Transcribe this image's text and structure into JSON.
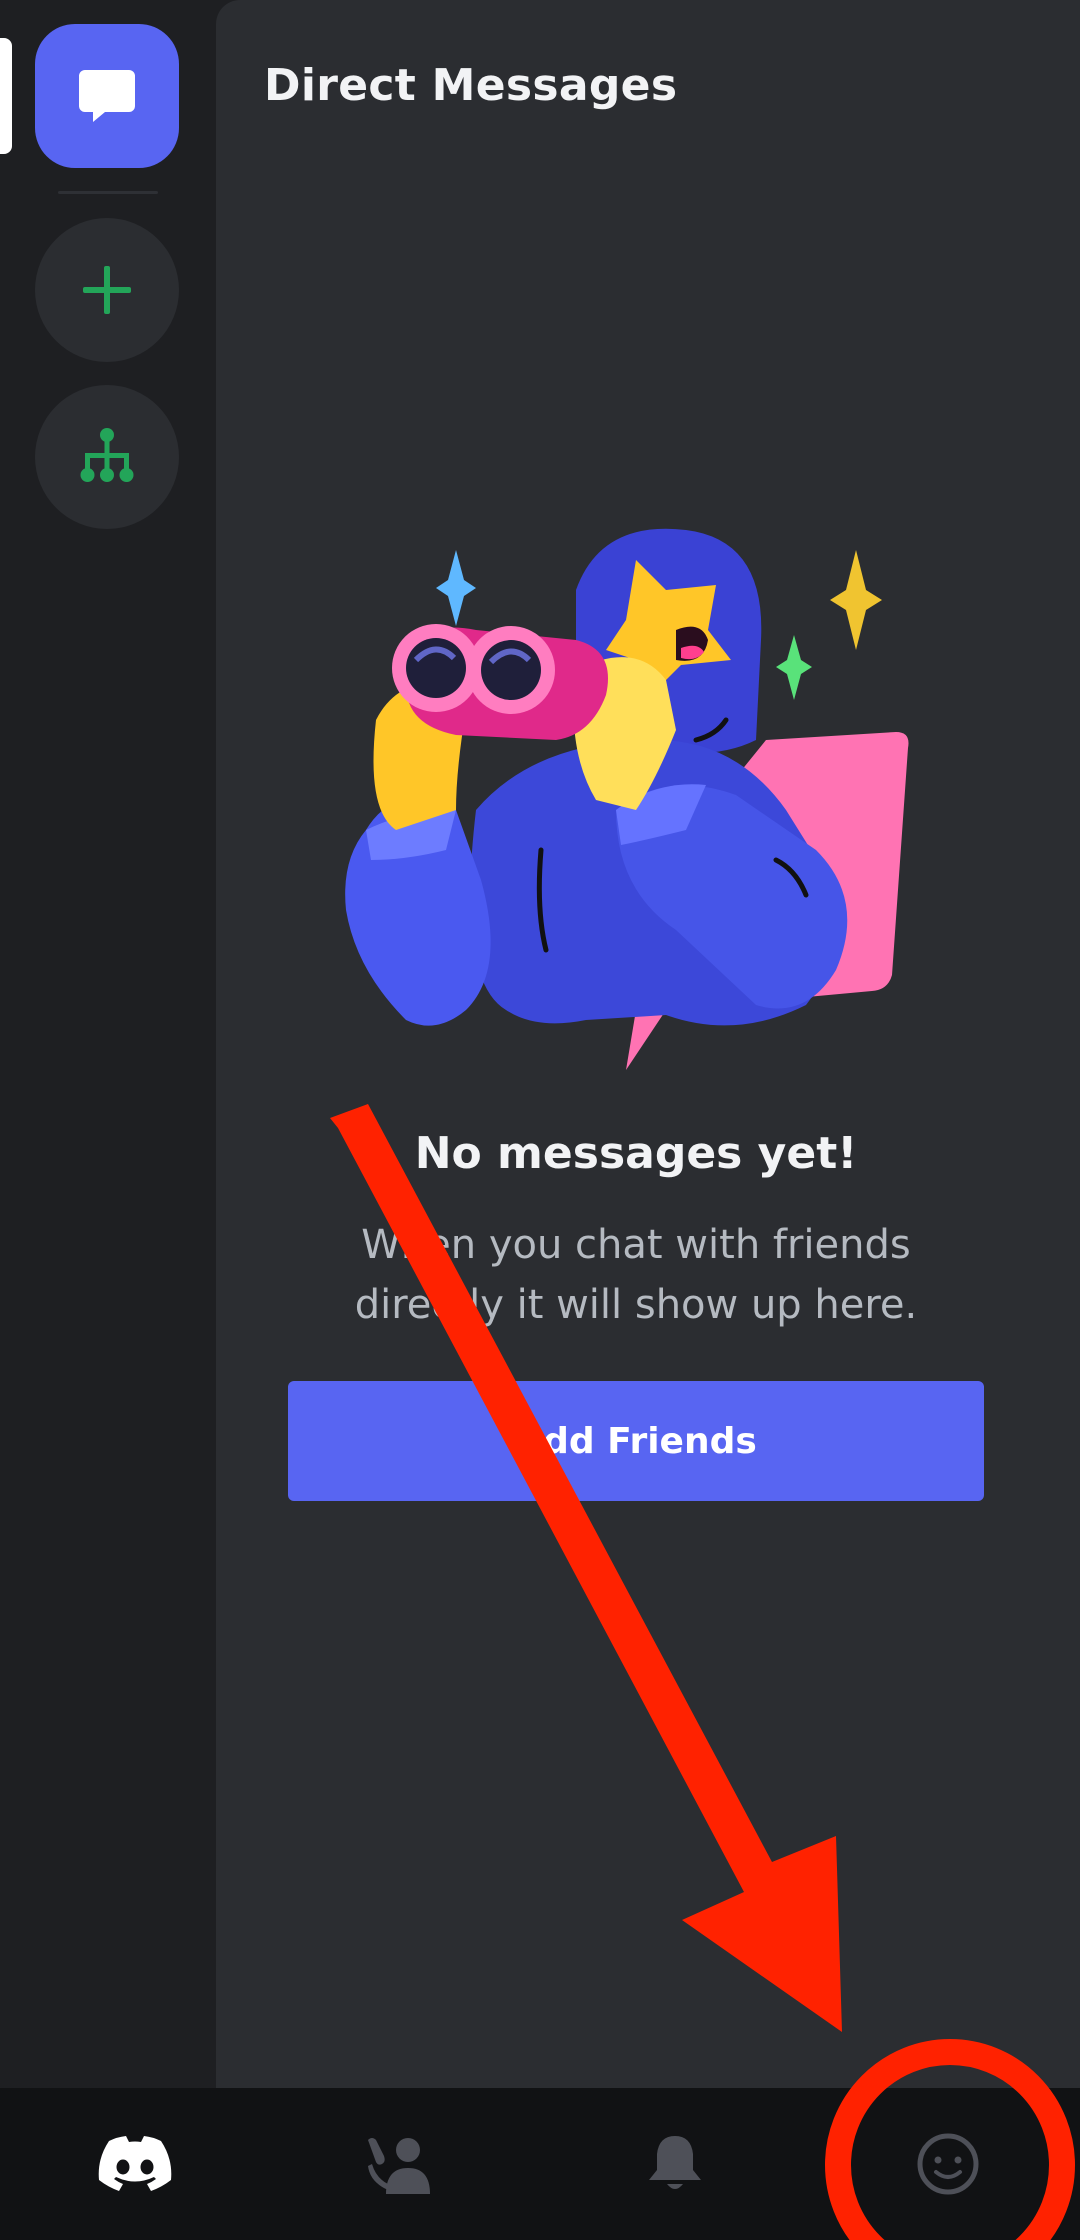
{
  "panel": {
    "title": "Direct Messages"
  },
  "empty_state": {
    "title": "No messages yet!",
    "description": "When you chat with friends directly it will show up here.",
    "button_label": "Add Friends"
  },
  "rail": {
    "items": [
      {
        "name": "direct-messages",
        "icon": "chat-bubble-icon"
      },
      {
        "name": "add-server",
        "icon": "plus-icon"
      },
      {
        "name": "discover-servers",
        "icon": "hub-tree-icon"
      }
    ]
  },
  "bottom_nav": {
    "items": [
      {
        "name": "home",
        "icon": "discord-logo-icon"
      },
      {
        "name": "friends",
        "icon": "friends-wave-icon"
      },
      {
        "name": "notifications",
        "icon": "bell-icon"
      },
      {
        "name": "profile",
        "icon": "smiley-avatar-icon"
      }
    ]
  },
  "colors": {
    "background": "#1e1f22",
    "panel": "#2b2d31",
    "brand": "#5865f2",
    "green": "#23a559",
    "nav_background": "#111214",
    "annotation_red": "#ff2200"
  }
}
